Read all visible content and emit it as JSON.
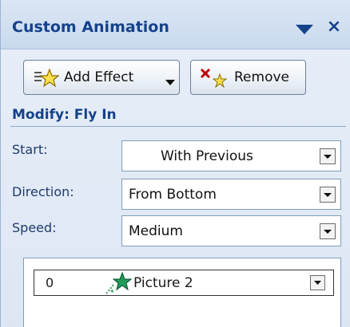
{
  "pane": {
    "title": "Custom Animation"
  },
  "toolbar": {
    "add_effect_label": "Add Effect",
    "remove_label": "Remove"
  },
  "modify": {
    "heading": "Modify: Fly In",
    "start": {
      "label": "Start:",
      "value": "With Previous"
    },
    "direction": {
      "label": "Direction:",
      "value": "From Bottom"
    },
    "speed": {
      "label": "Speed:",
      "value": "Medium"
    }
  },
  "animation_list": {
    "items": [
      {
        "order": "0",
        "name": "Picture 2",
        "icon": "star-motion-icon"
      }
    ]
  },
  "colors": {
    "title_blue": "#15428b",
    "pane_bg": "#dde7f4"
  }
}
